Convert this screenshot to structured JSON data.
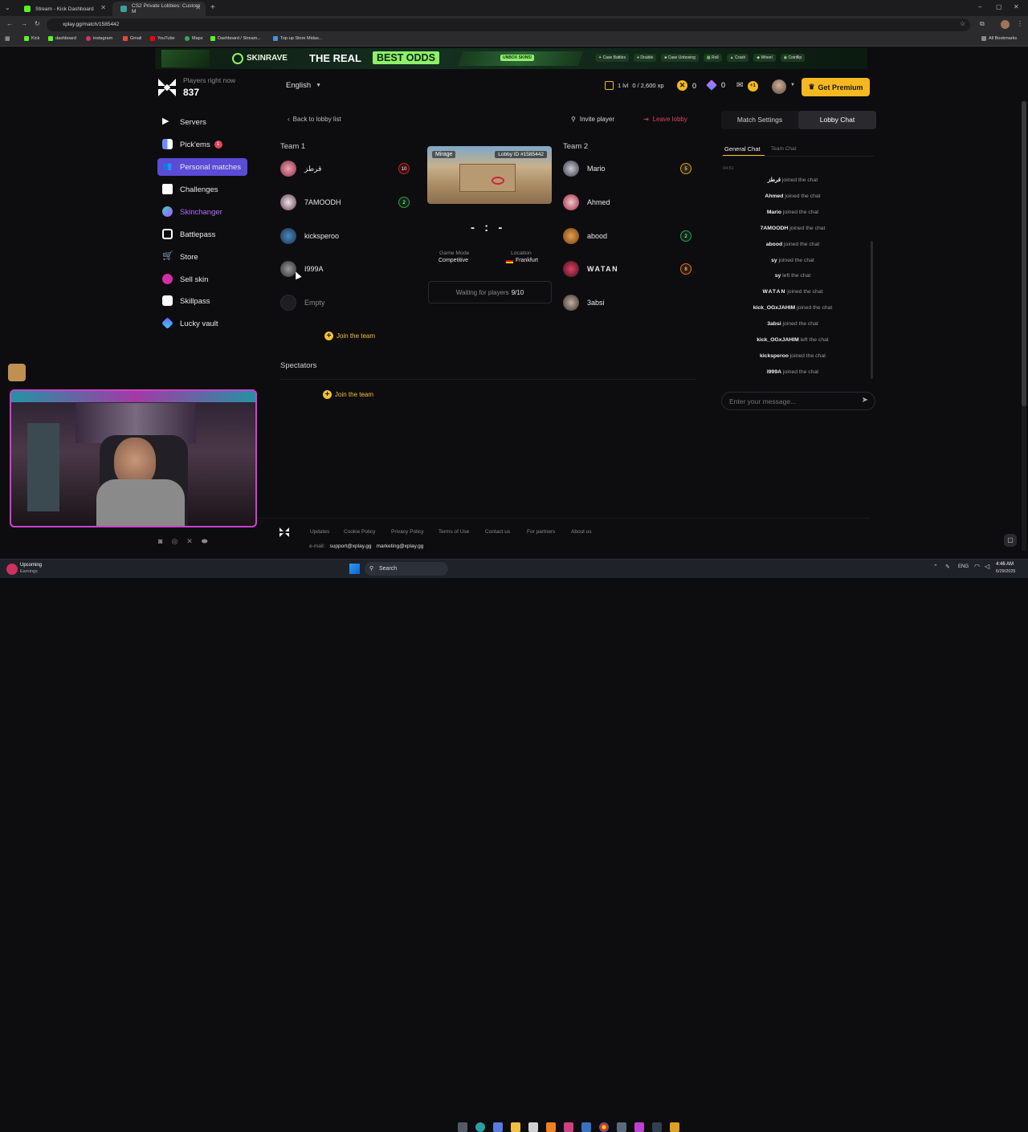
{
  "browser": {
    "tabs": [
      {
        "label": "Stream - Kick Dashboard",
        "active": false
      },
      {
        "label": "CS2 Private Lobbies: Custom M",
        "active": true
      }
    ],
    "url": "xplay.gg/match/1585442",
    "bookmarks": [
      "Kick",
      "dashboard",
      "instagram",
      "Gmail",
      "YouTube",
      "Maps",
      "Dashboard / Stream...",
      "Top-up Store Midas..."
    ],
    "all_bookmarks": "All Bookmarks"
  },
  "banner": {
    "brand": "SKINRAVE",
    "headline_plain": "THE REAL",
    "headline_highlight": "BEST ODDS",
    "badge": "UNBOX SKINS!",
    "games": [
      "Case Battles",
      "Double",
      "Case Unboxing",
      "Roll",
      "Crash",
      "Wheel",
      "Coinflip"
    ]
  },
  "header": {
    "players_label": "Players right now",
    "players_count": "837",
    "language": "English",
    "level": "1 lvl",
    "xp": "0 / 2,600 xp",
    "coins": "0",
    "gems": "0",
    "mail_badge": "+1",
    "premium": "Get Premium"
  },
  "sidebar": {
    "items": [
      {
        "label": "Servers",
        "icon": "play-icon"
      },
      {
        "label": "Pick'ems",
        "icon": "pickems-icon",
        "badge": "1"
      },
      {
        "label": "Personal matches",
        "icon": "users-icon",
        "active": true
      },
      {
        "label": "Challenges",
        "icon": "challenge-icon"
      },
      {
        "label": "Skinchanger",
        "icon": "skinchanger-icon"
      },
      {
        "label": "Battlepass",
        "icon": "battlepass-icon"
      },
      {
        "label": "Store",
        "icon": "cart-icon"
      },
      {
        "label": "Sell skin",
        "icon": "sell-icon"
      },
      {
        "label": "Skillpass",
        "icon": "skillpass-icon"
      },
      {
        "label": "Lucky vault",
        "icon": "vault-icon"
      }
    ]
  },
  "lobby": {
    "back": "Back to lobby list",
    "invite": "Invite player",
    "leave": "Leave lobby",
    "team1_title": "Team 1",
    "team2_title": "Team 2",
    "team1": [
      {
        "name": "قرطز",
        "rank": "10",
        "rank_color": "#c0262d"
      },
      {
        "name": "7AMOODH",
        "rank": "2",
        "rank_color": "#2f9e44"
      },
      {
        "name": "kicksperoo",
        "rank": "",
        "rank_color": ""
      },
      {
        "name": "I999A",
        "rank": "",
        "rank_color": ""
      },
      {
        "name": "Empty",
        "rank": "",
        "rank_color": ""
      }
    ],
    "team2": [
      {
        "name": "Mario",
        "rank": "5",
        "rank_color": "#d4a017"
      },
      {
        "name": "Ahmed",
        "rank": "",
        "rank_color": ""
      },
      {
        "name": "abood",
        "rank": "2",
        "rank_color": "#2f9e44"
      },
      {
        "name": "WATAN",
        "rank": "8",
        "rank_color": "#e07020"
      },
      {
        "name": "3absi",
        "rank": "",
        "rank_color": ""
      }
    ],
    "join_team": "Join the team",
    "map_name": "Mirage",
    "lobby_id": "Lobby ID #1585442",
    "score": "- : -",
    "game_mode_label": "Game Mode",
    "game_mode": "Competitive",
    "location_label": "Location",
    "location": "Frankfurt",
    "waiting_text": "Waiting for players",
    "waiting_count": "9/10",
    "spectators_title": "Spectators",
    "spectators_join": "Join the team"
  },
  "chat": {
    "tab_settings": "Match Settings",
    "tab_chat": "Lobby Chat",
    "sub_general": "General Chat",
    "sub_team": "Team Chat",
    "time": "04:51",
    "lines": [
      {
        "name": "قرطز",
        "text": "joined the chat"
      },
      {
        "name": "Ahmed",
        "text": "joined the chat"
      },
      {
        "name": "Mario",
        "text": "joined the chat"
      },
      {
        "name": "7AMOODH",
        "text": "joined the chat"
      },
      {
        "name": "abood",
        "text": "joined the chat"
      },
      {
        "name": "sy",
        "text": "joined the chat"
      },
      {
        "name": "sy",
        "text": "left the chat"
      },
      {
        "name": "WATAN",
        "text": "joined the chat"
      },
      {
        "name": "kick_OGxJAHIM",
        "text": "joined the chat"
      },
      {
        "name": "3absi",
        "text": "joined the chat"
      },
      {
        "name": "kick_OGxJAHIM",
        "text": "left the chat"
      },
      {
        "name": "kicksperoo",
        "text": "joined the chat"
      },
      {
        "name": "I999A",
        "text": "joined the chat"
      }
    ],
    "placeholder": "Enter your message..."
  },
  "footer": {
    "links": [
      "Updates",
      "Cookie Policy",
      "Privacy Policy",
      "Terms of Use",
      "Contact us",
      "For partners",
      "About us"
    ],
    "email_label": "e-mail:",
    "email_support": "support@xplay.gg",
    "email_marketing": "marketing@xplay.gg"
  },
  "taskbar": {
    "weather_title": "Upcoming",
    "weather_sub": "Earnings",
    "search": "Search",
    "lang": "ENG",
    "time": "4:46 AM",
    "date": "6/29/2025"
  },
  "colors": {
    "accent_yellow": "#f5b820",
    "active_purple": "#5b4bd6",
    "leave_red": "#e0455a",
    "join_yellow": "#f2c230"
  }
}
